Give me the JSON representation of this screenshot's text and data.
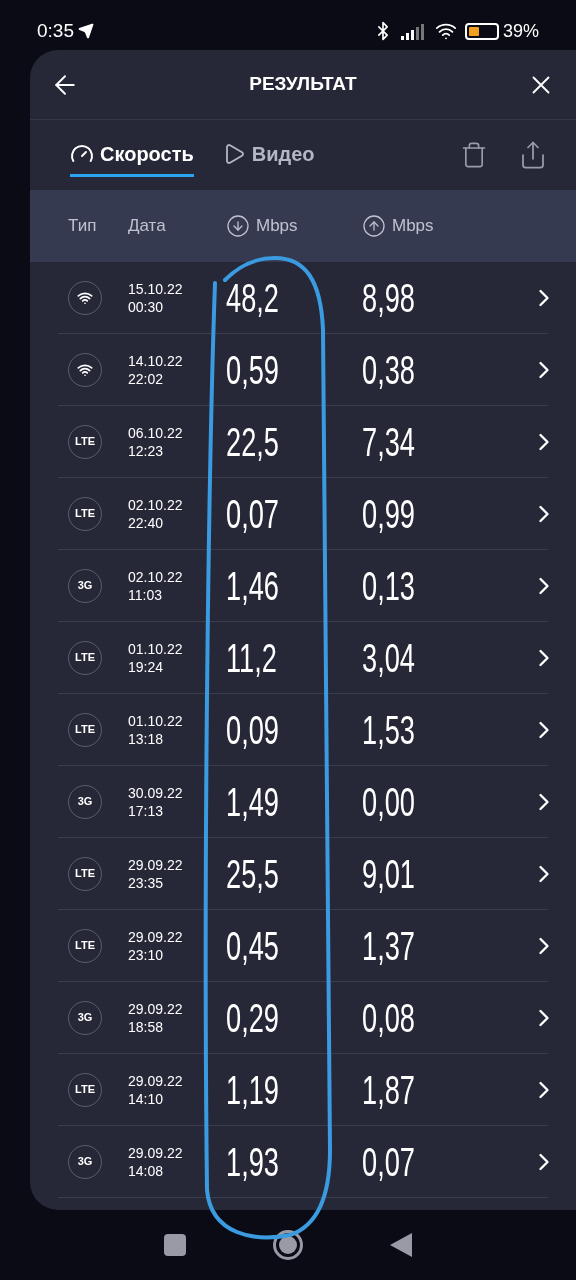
{
  "status_bar": {
    "time": "0:35",
    "battery_text": "39%"
  },
  "header": {
    "title": "РЕЗУЛЬТАТ"
  },
  "tabs": [
    {
      "label": "Скорость",
      "selected": true
    },
    {
      "label": "Видео",
      "selected": false
    }
  ],
  "table": {
    "columns": [
      {
        "label": "Тип"
      },
      {
        "label": "Дата"
      },
      {
        "label": "Mbps"
      },
      {
        "label": "Mbps"
      }
    ],
    "rows": [
      {
        "kind": "wifi",
        "date": "15.10.22",
        "time": "00:30",
        "download": "48,2",
        "upload": "8,98"
      },
      {
        "kind": "wifi",
        "date": "14.10.22",
        "time": "22:02",
        "download": "0,59",
        "upload": "0,38"
      },
      {
        "kind": "text",
        "badge": "LTE",
        "date": "06.10.22",
        "time": "12:23",
        "download": "22,5",
        "upload": "7,34"
      },
      {
        "kind": "text",
        "badge": "LTE",
        "date": "02.10.22",
        "time": "22:40",
        "download": "0,07",
        "upload": "0,99"
      },
      {
        "kind": "text",
        "badge": "3G",
        "date": "02.10.22",
        "time": "11:03",
        "download": "1,46",
        "upload": "0,13"
      },
      {
        "kind": "text",
        "badge": "LTE",
        "date": "01.10.22",
        "time": "19:24",
        "download": "11,2",
        "upload": "3,04"
      },
      {
        "kind": "text",
        "badge": "LTE",
        "date": "01.10.22",
        "time": "13:18",
        "download": "0,09",
        "upload": "1,53"
      },
      {
        "kind": "text",
        "badge": "3G",
        "date": "30.09.22",
        "time": "17:13",
        "download": "1,49",
        "upload": "0,00"
      },
      {
        "kind": "text",
        "badge": "LTE",
        "date": "29.09.22",
        "time": "23:35",
        "download": "25,5",
        "upload": "9,01"
      },
      {
        "kind": "text",
        "badge": "LTE",
        "date": "29.09.22",
        "time": "23:10",
        "download": "0,45",
        "upload": "1,37"
      },
      {
        "kind": "text",
        "badge": "3G",
        "date": "29.09.22",
        "time": "18:58",
        "download": "0,29",
        "upload": "0,08"
      },
      {
        "kind": "text",
        "badge": "LTE",
        "date": "29.09.22",
        "time": "14:10",
        "download": "1,19",
        "upload": "1,87"
      },
      {
        "kind": "text",
        "badge": "3G",
        "date": "29.09.22",
        "time": "14:08",
        "download": "1,93",
        "upload": "0,07"
      }
    ]
  }
}
